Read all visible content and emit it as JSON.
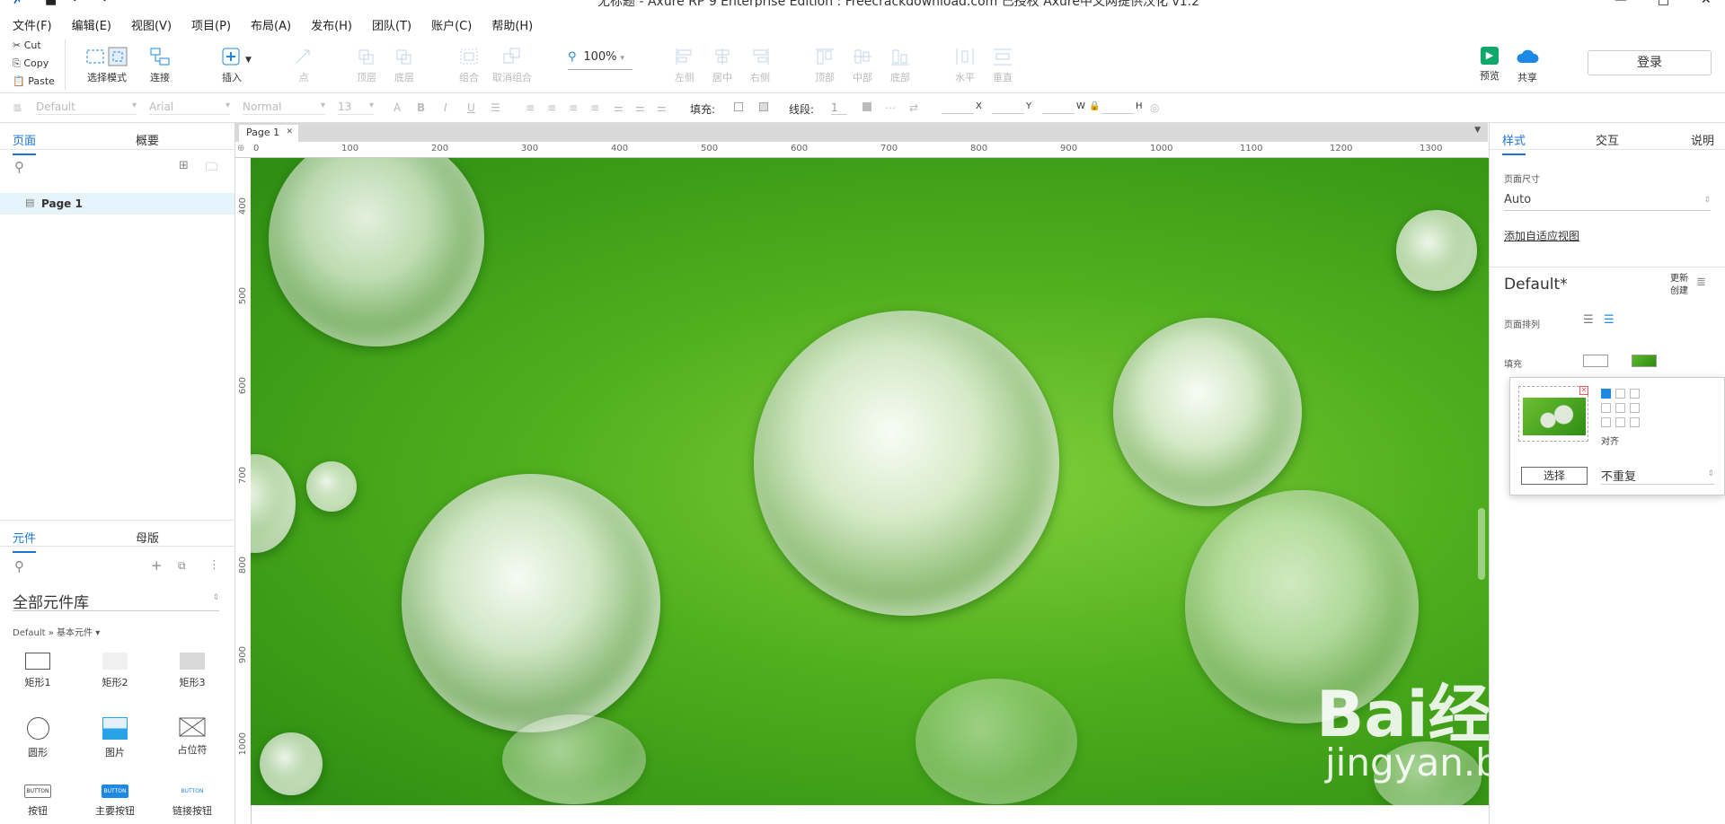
{
  "window": {
    "title": "无标题 - Axure RP 9 Enterprise Edition : Freecrackdownload.com 已授权    Axure中文网提供汉化 v1.2"
  },
  "menu": [
    "文件(F)",
    "编辑(E)",
    "视图(V)",
    "项目(P)",
    "布局(A)",
    "发布(H)",
    "团队(T)",
    "账户(C)",
    "帮助(H)"
  ],
  "clipboard": {
    "cut": "Cut",
    "copy": "Copy",
    "paste": "Paste"
  },
  "toolbar": {
    "select_mode": "选择模式",
    "connect": "连接",
    "insert": "插入",
    "point": "点",
    "top_layer": "顶层",
    "bottom_layer": "底层",
    "group": "组合",
    "ungroup": "取消组合",
    "zoom": "100%",
    "align_left": "左侧",
    "align_center": "居中",
    "align_right": "右侧",
    "align_top": "顶部",
    "align_middle": "中部",
    "align_bottom": "底部",
    "dist_h": "水平",
    "dist_v": "垂直",
    "preview": "预览",
    "share": "共享",
    "login": "登录",
    "accent": "#1e88e5",
    "preview_color": "#13a86b"
  },
  "formatbar": {
    "style": "Default",
    "font": "Arial",
    "weight": "Normal",
    "size": "13",
    "fill_label": "填充:",
    "line_label": "线段:",
    "line_width": "1",
    "x_label": "X",
    "y_label": "Y",
    "w_label": "W",
    "h_label": "H"
  },
  "left": {
    "tabs_top": [
      "页面",
      "概要"
    ],
    "page": "Page 1",
    "tabs_bottom": [
      "元件",
      "母版"
    ],
    "library": "全部元件库",
    "breadcrumb": "Default » 基本元件 ▾",
    "widgets": [
      "矩形1",
      "矩形2",
      "矩形3",
      "圆形",
      "图片",
      "占位符",
      "按钮",
      "主要按钮",
      "链接按钮"
    ],
    "button_text": "BUTTON"
  },
  "canvas": {
    "tab": "Page 1",
    "hticks": [
      "0",
      "100",
      "200",
      "300",
      "400",
      "500",
      "600",
      "700",
      "800",
      "900",
      "1000",
      "1100",
      "1200",
      "1300"
    ],
    "vticks": [
      "400",
      "500",
      "600",
      "700",
      "800",
      "900",
      "1000"
    ],
    "watermark": "Bai经验",
    "watermark_url": "jingyan.baidu.com",
    "arrow_color": "#e62ed6"
  },
  "right": {
    "tabs": [
      "样式",
      "交互",
      "说明"
    ],
    "page_size_label": "页面尺寸",
    "page_size": "Auto",
    "adaptive_link": "添加自适应视图",
    "style_name": "Default*",
    "update": "更新",
    "create": "创建",
    "arrange_label": "页面排列",
    "fill_label": "填充",
    "align_label": "对齐",
    "select_btn": "选择",
    "repeat": "不重复"
  }
}
